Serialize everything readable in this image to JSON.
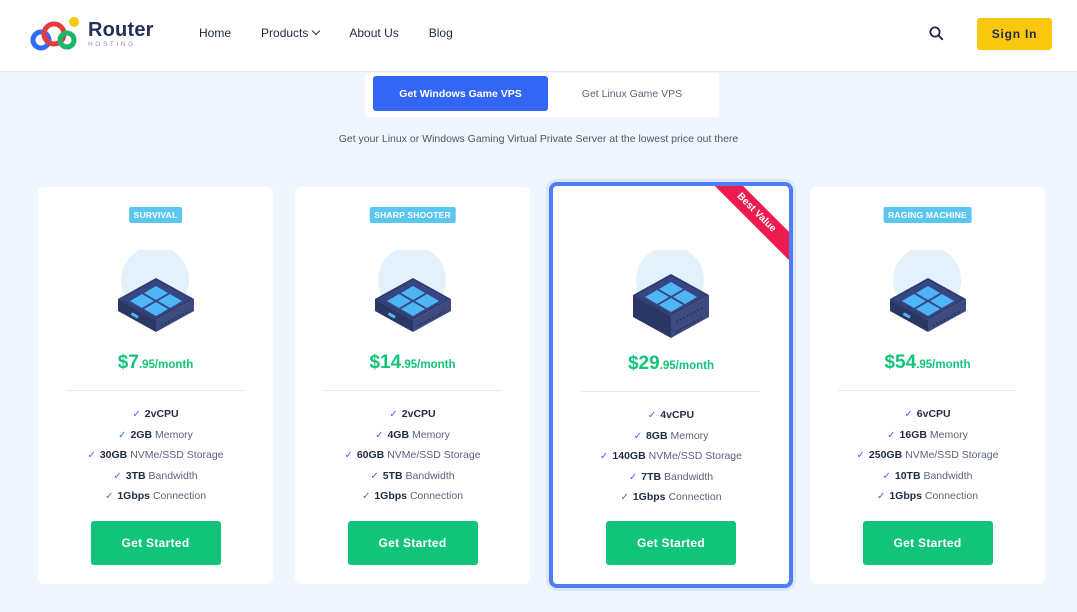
{
  "brand": {
    "name": "Router",
    "tagline": "HOSTING",
    "colors": {
      "red": "#e63b3b",
      "blue": "#2f6cf5",
      "yellow": "#f6c811",
      "navy": "#22315a"
    }
  },
  "nav": {
    "items": [
      {
        "label": "Home"
      },
      {
        "label": "Products",
        "has_dropdown": true
      },
      {
        "label": "About Us"
      },
      {
        "label": "Blog"
      }
    ],
    "search_icon": "search-icon",
    "signin_label": "Sign In"
  },
  "tabs": [
    {
      "label": "Get Windows Game VPS",
      "active": true
    },
    {
      "label": "Get Linux Game VPS",
      "active": false
    }
  ],
  "subtitle": "Get your Linux or Windows Gaming Virtual Private Server at the lowest price out there",
  "plans": [
    {
      "badge": "SURVIVAL",
      "price_main": "$7",
      "price_rest": ".95/month",
      "featured": false,
      "server_icon": "server-small-icon",
      "features": [
        {
          "value": "2vCPU",
          "label": ""
        },
        {
          "value": "2GB",
          "label": "Memory"
        },
        {
          "value": "30GB",
          "label": "NVMe/SSD Storage"
        },
        {
          "value": "3TB",
          "label": "Bandwidth"
        },
        {
          "value": "1Gbps",
          "label": "Connection"
        }
      ],
      "cta": "Get Started"
    },
    {
      "badge": "SHARP SHOOTER",
      "price_main": "$14",
      "price_rest": ".95/month",
      "featured": false,
      "server_icon": "server-small-icon",
      "features": [
        {
          "value": "2vCPU",
          "label": ""
        },
        {
          "value": "4GB",
          "label": "Memory"
        },
        {
          "value": "60GB",
          "label": "NVMe/SSD Storage"
        },
        {
          "value": "5TB",
          "label": "Bandwidth"
        },
        {
          "value": "1Gbps",
          "label": "Connection"
        }
      ],
      "cta": "Get Started"
    },
    {
      "badge": "",
      "ribbon": "Best Value",
      "price_main": "$29",
      "price_rest": ".95/month",
      "featured": true,
      "server_icon": "server-stacked-icon",
      "features": [
        {
          "value": "4vCPU",
          "label": ""
        },
        {
          "value": "8GB",
          "label": "Memory"
        },
        {
          "value": "140GB",
          "label": "NVMe/SSD Storage"
        },
        {
          "value": "7TB",
          "label": "Bandwidth"
        },
        {
          "value": "1Gbps",
          "label": "Connection"
        }
      ],
      "cta": "Get Started"
    },
    {
      "badge": "RAGING MACHINE",
      "price_main": "$54",
      "price_rest": ".95/month",
      "featured": false,
      "server_icon": "server-small-icon",
      "features": [
        {
          "value": "6vCPU",
          "label": ""
        },
        {
          "value": "16GB",
          "label": "Memory"
        },
        {
          "value": "250GB",
          "label": "NVMe/SSD Storage"
        },
        {
          "value": "10TB",
          "label": "Bandwidth"
        },
        {
          "value": "1Gbps",
          "label": "Connection"
        }
      ],
      "cta": "Get Started"
    }
  ],
  "colors": {
    "accent_blue": "#3366f4",
    "price_green": "#12c47a",
    "badge_blue": "#5bc6f2",
    "ribbon_red": "#ec1d4e",
    "signin_yellow": "#f9c80e"
  }
}
